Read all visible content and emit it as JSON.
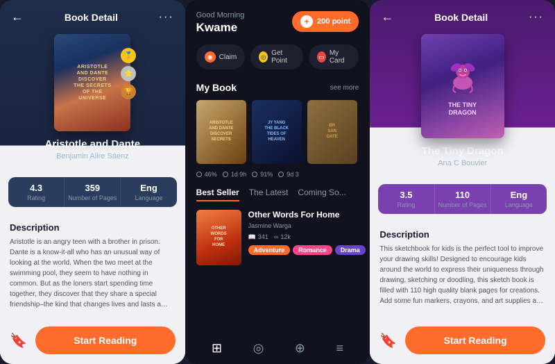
{
  "left_phone": {
    "header": {
      "back": "←",
      "title": "Book Detail",
      "dots": "···"
    },
    "book": {
      "title": "Aristotle and Dante",
      "author": "Benjamin Alire Sáenz",
      "cover_lines": [
        "Aristotle",
        "and",
        "Dante",
        "Discover",
        "the",
        "Secrets",
        "of the",
        "Universe"
      ]
    },
    "stats": {
      "rating_value": "4.3",
      "rating_label": "Rating",
      "pages_value": "359",
      "pages_label": "Number of Pages",
      "lang_value": "Eng",
      "lang_label": "Language"
    },
    "description": {
      "title": "Description",
      "text": "Aristotle is an angry teen with a brother in prison. Dante is a know-it-all who has an unusual way of looking at the world. When the two meet at the swimming pool, they seem to have nothing in common. But as the loners start spending time together, they discover that they share a special friendship–the kind that changes lives and lasts a lifetime. And it"
    },
    "bottom": {
      "bookmark_icon": "🔖",
      "start_reading": "Start Reading"
    }
  },
  "middle_phone": {
    "header": {
      "greeting": "Good Morning",
      "name": "Kwame",
      "points_plus": "+",
      "points_label": "200 point"
    },
    "actions": [
      {
        "icon": "◉",
        "label": "Claim",
        "color": "claim"
      },
      {
        "icon": "◎",
        "label": "Get Point",
        "color": "point"
      },
      {
        "icon": "▭",
        "label": "My Card",
        "color": "card"
      }
    ],
    "my_book": {
      "title": "My Book",
      "see_more": "see more",
      "books": [
        {
          "title": "Aristotle and Dante Discover the Secrets of the Universe"
        },
        {
          "title": "JY YANG THE BLACK TIDES OF HEAVEN"
        },
        {
          "title": "BR SAN OATE"
        }
      ],
      "progress": [
        {
          "percent": "46%"
        },
        {
          "time": "1d 9h",
          "percent": "91%"
        },
        {
          "time": "9d 3"
        }
      ]
    },
    "bestseller": {
      "tabs": [
        "Best Seller",
        "The Latest",
        "Coming So..."
      ],
      "active_tab": 0,
      "book": {
        "title": "Other Words For Home",
        "author": "Jasmine Warga",
        "stats": [
          {
            "icon": "📖",
            "value": "341"
          },
          {
            "icon": "∞",
            "value": "12k"
          }
        ],
        "tags": [
          "Adventure",
          "Romance",
          "Drama"
        ],
        "cover_lines": [
          "Other",
          "Words",
          "For",
          "Home"
        ]
      }
    },
    "nav": {
      "icons": [
        "⊞",
        "◎",
        "⊕",
        "≡"
      ]
    }
  },
  "right_phone": {
    "header": {
      "back": "←",
      "title": "Book Detail",
      "dots": "···"
    },
    "book": {
      "title": "The Tiny Dragon",
      "author": "Ana C Bouvier"
    },
    "stats": {
      "rating_value": "3.5",
      "rating_label": "Rating",
      "pages_value": "110",
      "pages_label": "Number of Pages",
      "lang_value": "Eng",
      "lang_label": "Language"
    },
    "description": {
      "title": "Description",
      "text": "This sketchbook for kids is the perfect tool to improve your drawing skills! Designed to encourage kids around the world to express their uniqueness through drawing, sketching or doodling, this sketch book is filled with 110 high quality blank pages for creations. Add some fun markers, crayons, and art supplies and you have the perfect, easy gift for kids!"
    },
    "bottom": {
      "bookmark_icon": "🔖",
      "start_reading": "Start Reading"
    }
  }
}
